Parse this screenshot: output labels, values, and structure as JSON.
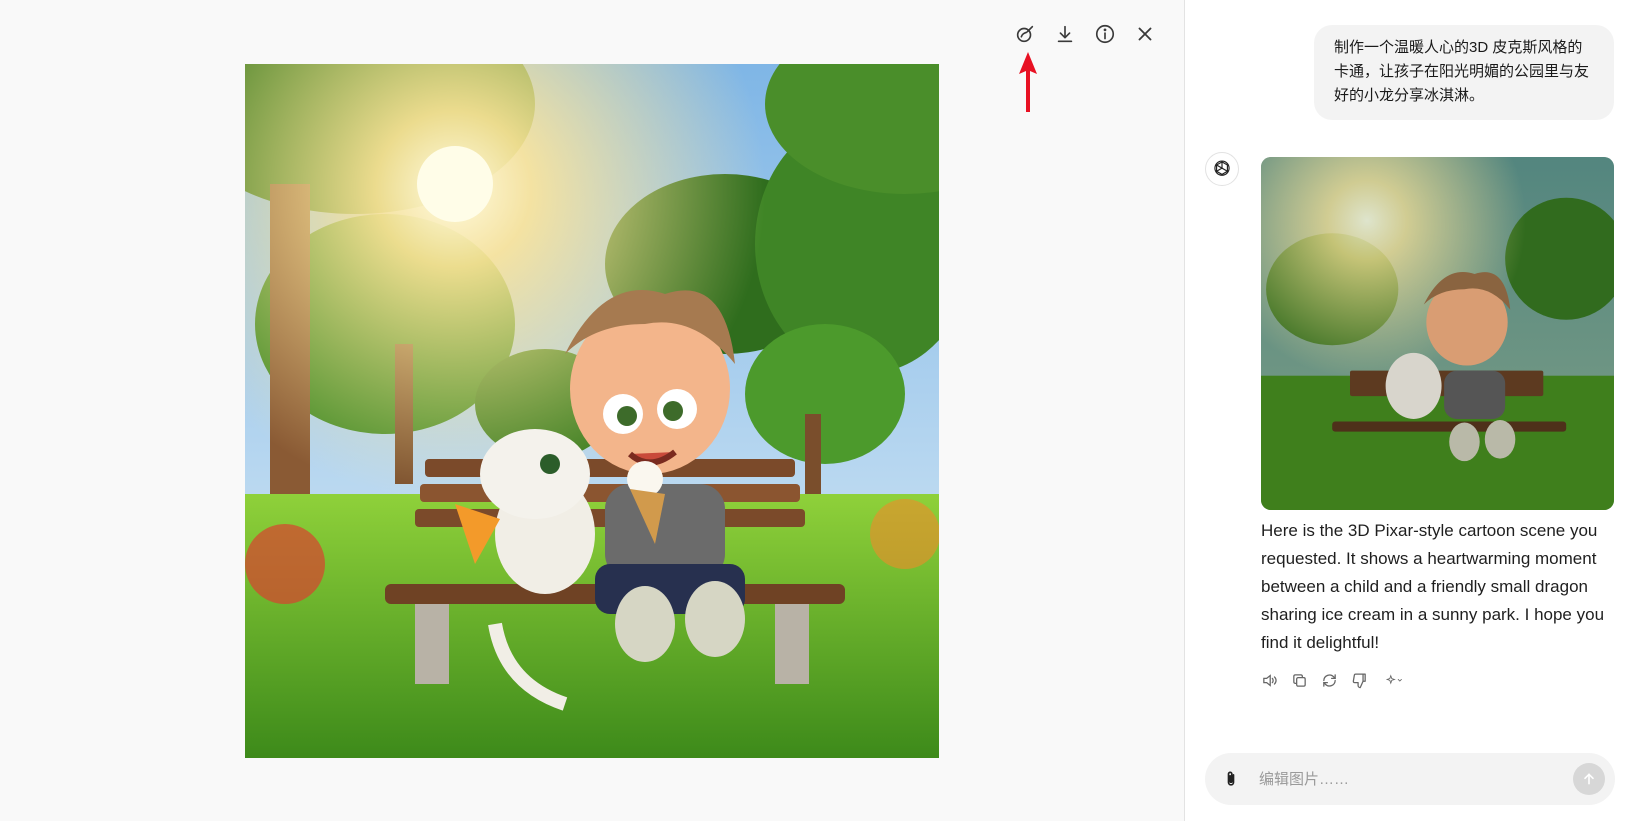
{
  "viewer": {
    "toolbar": [
      {
        "name": "edit-image-button",
        "icon": "edit-brush-icon"
      },
      {
        "name": "download-button",
        "icon": "download-icon"
      },
      {
        "name": "info-button",
        "icon": "info-icon"
      },
      {
        "name": "close-button",
        "icon": "close-icon"
      }
    ],
    "annotation_color": "#e81123"
  },
  "chat": {
    "user_message": "制作一个温暖人心的3D 皮克斯风格的卡通，让孩子在阳光明媚的公园里与友好的小龙分享冰淇淋。",
    "assistant_reply": "Here is the 3D Pixar-style cartoon scene you requested. It shows a heartwarming moment between a child and a friendly small dragon sharing ice cream in a sunny park. I hope you find it delightful!",
    "actions": [
      "read-aloud-icon",
      "copy-icon",
      "regenerate-icon",
      "thumbs-down-icon",
      "sparkle-model-icon"
    ],
    "composer": {
      "placeholder": "编辑图片……"
    }
  },
  "colors": {
    "page_bg": "#f9f9f9",
    "bubble_bg": "#f3f3f3",
    "send_disabled": "#d7d7d7"
  }
}
